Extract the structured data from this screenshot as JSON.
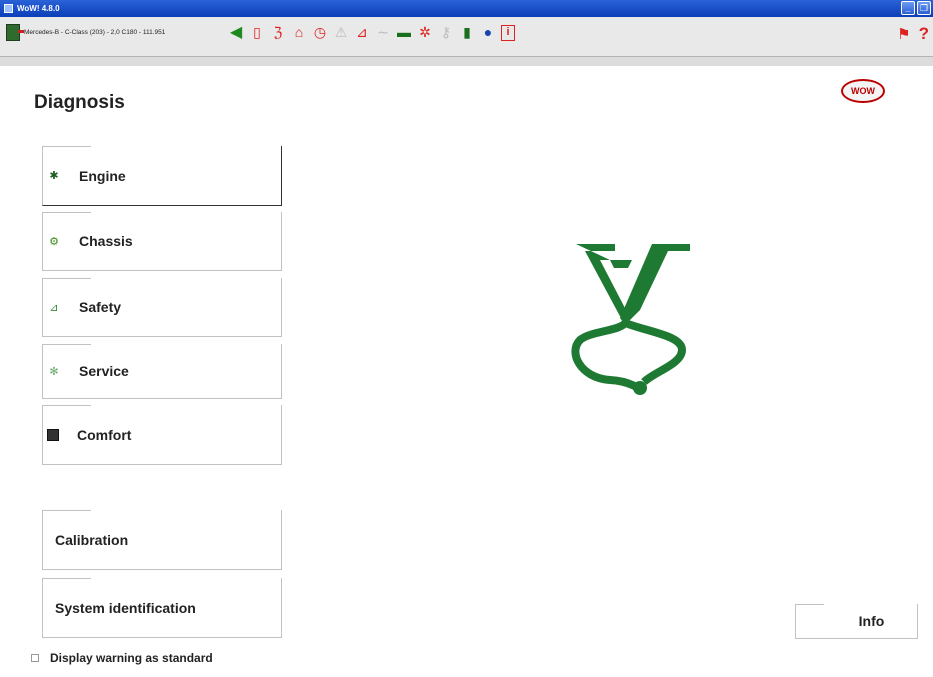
{
  "window": {
    "title": "WoW! 4.8.0",
    "controls": [
      "minimize-icon",
      "restore-icon"
    ]
  },
  "toolbar": {
    "vehicle": "Mercedes-B - C-Class (203) - 2,0 C180 - 111.951",
    "icons": [
      "back-arrow-icon",
      "exit-icon",
      "stethoscope-icon",
      "seat-icon",
      "clock-icon",
      "warning-triangle-icon",
      "seat-help-icon",
      "connection-icon",
      "laptop-icon",
      "tools-icon",
      "key-icon",
      "book-icon",
      "globe-icon",
      "info-icon"
    ],
    "right_icons": [
      "flag-icon",
      "help-icon"
    ],
    "help_label": "?",
    "info_label": "i"
  },
  "main": {
    "title": "Diagnosis",
    "logo_text": "WOW",
    "menu": [
      {
        "label": "Engine",
        "icon": "engine-icon",
        "active": true
      },
      {
        "label": "Chassis",
        "icon": "chassis-icon",
        "active": false
      },
      {
        "label": "Safety",
        "icon": "safety-icon",
        "active": false
      },
      {
        "label": "Service",
        "icon": "service-icon",
        "active": false
      },
      {
        "label": "Comfort",
        "icon": "comfort-icon",
        "active": false
      }
    ],
    "extra": [
      {
        "label": "Calibration"
      },
      {
        "label": "System identification"
      }
    ],
    "info_button": "Info",
    "warning_option": {
      "label": "Display warning as standard",
      "checked": false
    }
  },
  "colors": {
    "titlebar": "#0b3fb8",
    "accent_green": "#1e7a32",
    "toolbar_red": "#dd2222"
  }
}
